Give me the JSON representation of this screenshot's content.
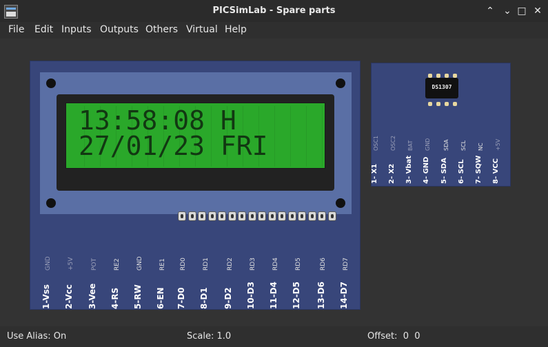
{
  "window": {
    "title": "PICSimLab - Spare parts"
  },
  "menu": [
    "File",
    "Edit",
    "Inputs",
    "Outputs",
    "Others",
    "Virtual",
    "Help"
  ],
  "lcd": {
    "line1": "13:58:08 H",
    "line2": "27/01/23 FRI",
    "signals": [
      "GND",
      "+5V",
      "POT",
      "RE2",
      "GND",
      "RE1",
      "RD0",
      "RD1",
      "RD2",
      "RD3",
      "RD4",
      "RD5",
      "RD6",
      "RD7"
    ],
    "pins": [
      "1-Vss",
      "2-Vcc",
      "3-Vee",
      "4-RS",
      "5-RW",
      "6-EN",
      "7-D0",
      "8-D1",
      "9-D2",
      "10-D3",
      "11-D4",
      "12-D5",
      "13-D6",
      "14-D7"
    ]
  },
  "rtc": {
    "chip_label": "DS1307",
    "signals": [
      "OSC1",
      "OSC2",
      "BAT",
      "GND",
      "SDA",
      "SCL",
      "NC",
      "+5V"
    ],
    "pins": [
      "1- X1",
      "2- X2",
      "3- Vbat",
      "4- GND",
      "5- SDA",
      "6- SCL",
      "7- SQW",
      "8- VCC"
    ]
  },
  "status": {
    "alias": "Use Alias: On",
    "scale": "Scale: 1.0",
    "offset": "Offset:  0  0"
  },
  "colors": {
    "board": "#38467a",
    "lcd_bg": "#2aa82a",
    "lcd_text": "#123812"
  }
}
